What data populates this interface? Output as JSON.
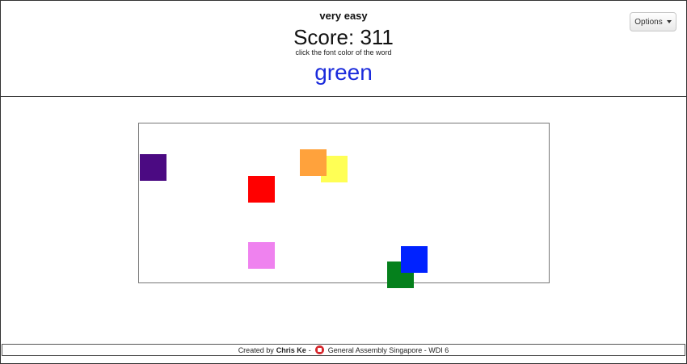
{
  "header": {
    "difficulty": "very easy",
    "score_text": "Score: 311",
    "instruction": "click the font color of the word",
    "word": "green",
    "word_color": "#1b2bdc"
  },
  "options": {
    "label": "Options"
  },
  "board": {
    "tiles": [
      {
        "name": "tile-purple",
        "color": "#4b0a82"
      },
      {
        "name": "tile-orange",
        "color": "#ffa23c"
      },
      {
        "name": "tile-yellow",
        "color": "#ffff55"
      },
      {
        "name": "tile-red",
        "color": "#ff0000"
      },
      {
        "name": "tile-pink",
        "color": "#ef82ef"
      },
      {
        "name": "tile-green",
        "color": "#05801c"
      },
      {
        "name": "tile-blue",
        "color": "#0022ff"
      }
    ]
  },
  "footer": {
    "created_by": "Created by",
    "author": "Chris Ke",
    "sep1": "-",
    "logo_icon": "general-assembly-logo-icon",
    "org": "General Assembly Singapore - WDI 6"
  }
}
